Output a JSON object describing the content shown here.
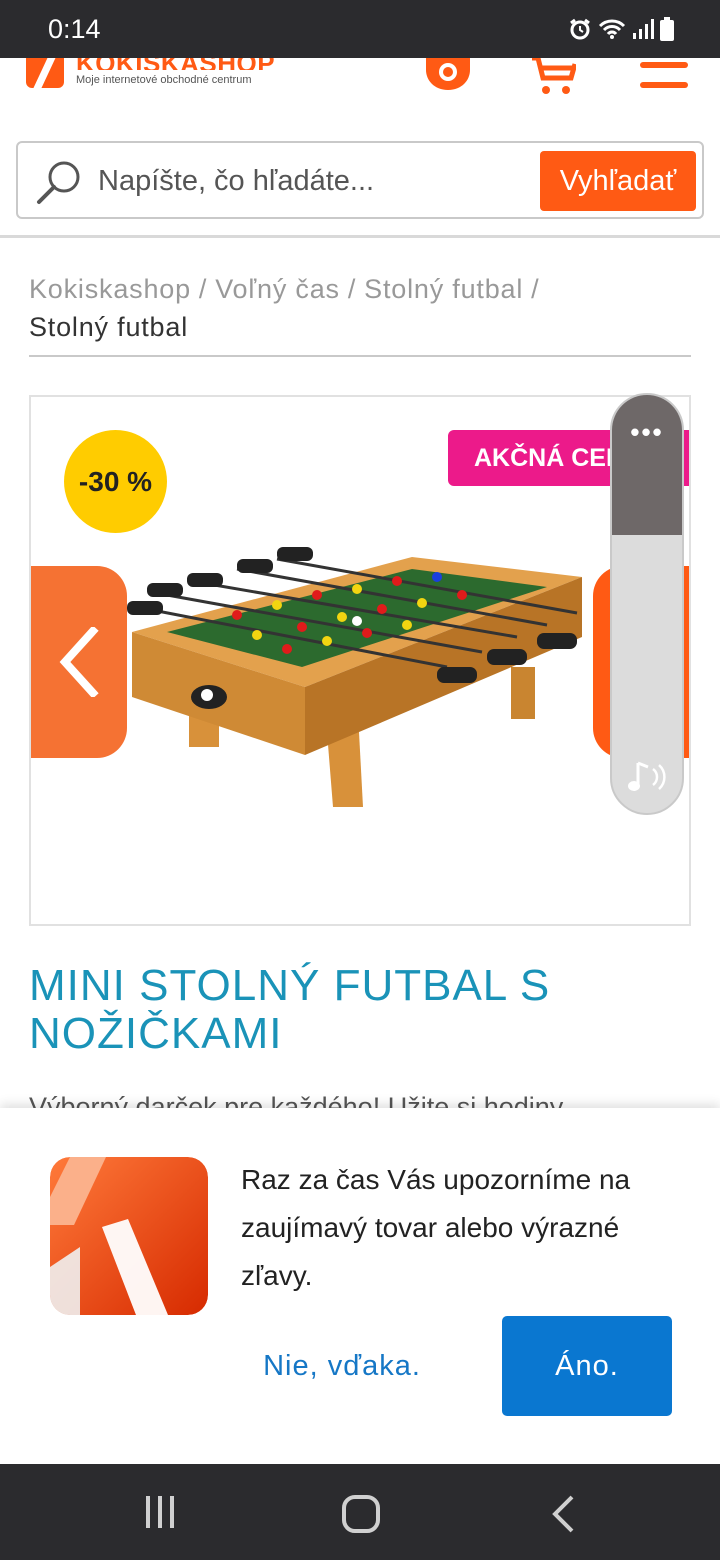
{
  "status": {
    "time": "0:14"
  },
  "header": {
    "logo_name": "KOKISKASHOP",
    "logo_tagline": "Moje internetové obchodné centrum",
    "icons": [
      "phone-icon",
      "cart-icon",
      "menu-icon"
    ]
  },
  "search": {
    "placeholder": "Napíšte, čo hľadáte...",
    "button_label": "Vyhľadať"
  },
  "breadcrumb": {
    "items": [
      "Kokiskashop",
      "Voľný čas",
      "Stolný futbal"
    ],
    "separator": "/",
    "current": "Stolný futbal"
  },
  "gallery": {
    "discount_badge": "-30 %",
    "promo_badge": "AKČNÁ CENA",
    "accent_color": "#ff5a14",
    "promo_color": "#ec1a8a",
    "badge_color": "#ffcc00"
  },
  "volume_panel": {
    "menu": "•••"
  },
  "product": {
    "title": "MINI STOLNÝ FUTBAL S NOŽIČKAMI",
    "description_preview": "Výborný darček pre každého! Užite si hodiny"
  },
  "push_prompt": {
    "message": "Raz za čas Vás upozorníme na zaujímavý tovar alebo výrazné zľavy.",
    "decline_label": "Nie, vďaka.",
    "accept_label": "Áno.",
    "accept_color": "#0a77d0"
  }
}
